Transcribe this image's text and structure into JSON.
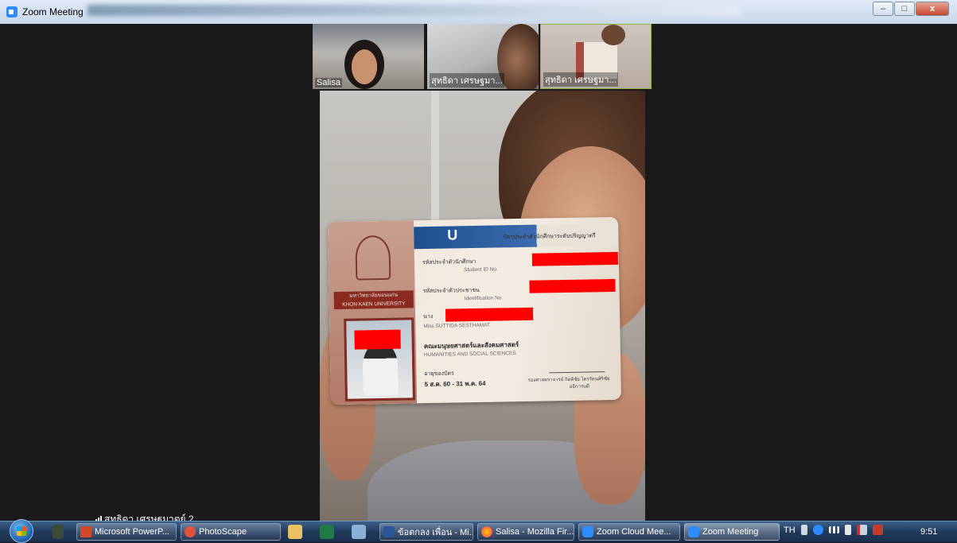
{
  "window": {
    "title": "Zoom Meeting",
    "minimize_label": "–",
    "maximize_label": "□",
    "close_label": "x"
  },
  "thumbnails": [
    {
      "name": "Salisa"
    },
    {
      "name": "สุทธิดา เศรษฐมา..."
    },
    {
      "name": "สุทธิดา เศรษฐมา..."
    }
  ],
  "id_card": {
    "badge": "U",
    "title": "บัตรประจำตัวนักศึกษาระดับปริญญาตรี",
    "university_th": "มหาวิทยาลัยขอนแก่น",
    "university_en": "KHON KAEN UNIVERSITY",
    "student_id_label": "รหัสประจำตัวนักศึกษา",
    "student_id_label_en": "Student ID No.",
    "national_id_label": "รหัสประจำตัวประชาชน",
    "national_id_label_en": "Identification No.",
    "name_prefix": "นาง",
    "name_en": "Miss SUTTIDA SESTHAMAT",
    "faculty_th": "คณะมนุษยศาสตร์และสังคมศาสตร์",
    "faculty_en": "HUMANITIES AND SOCIAL SCIENCES",
    "expiry_label": "อายุของบัตร",
    "expiry_value": "5 ส.ค. 60 - 31 พ.ค. 64",
    "signer": "รองศาสตราจารย์ กิตติชัย ไตรรัตนศิริชัย",
    "signer_title": "อธิการบดี"
  },
  "active_speaker": {
    "name": "สุทธิดา เศรษฐมาตย์ 2"
  },
  "taskbar": {
    "items": [
      {
        "label": "Microsoft PowerP...",
        "color": "#d24726"
      },
      {
        "label": "PhotoScape",
        "color": "#e0533a"
      },
      {
        "label": "ข้อตกลง เพื่อน - Mi...",
        "color": "#2b579a"
      },
      {
        "label": "Salisa - Mozilla Fir...",
        "color": "#ff7139"
      },
      {
        "label": "Zoom Cloud Mee...",
        "color": "#2d8cff"
      },
      {
        "label": "Zoom Meeting",
        "color": "#2d8cff"
      }
    ],
    "language": "TH",
    "clock": "9:51"
  }
}
